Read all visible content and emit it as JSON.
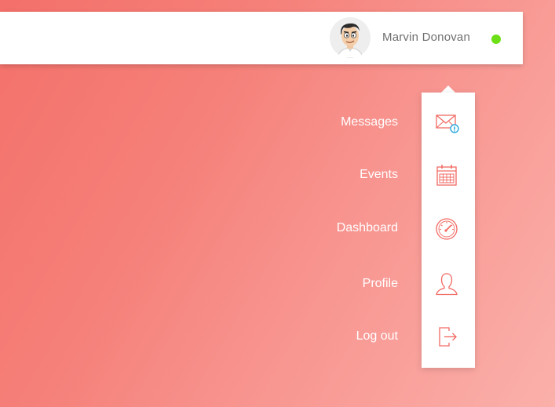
{
  "header": {
    "user_name": "Marvin Donovan",
    "status": "online",
    "status_color": "#6ddf17"
  },
  "menu": {
    "items": [
      {
        "label": "Messages",
        "icon": "mail-icon"
      },
      {
        "label": "Events",
        "icon": "calendar-icon"
      },
      {
        "label": "Dashboard",
        "icon": "speedometer-icon"
      },
      {
        "label": "Profile",
        "icon": "user-icon"
      },
      {
        "label": "Log out",
        "icon": "logout-icon"
      }
    ]
  },
  "colors": {
    "accent": "#f26a63",
    "background_start": "#f4706a",
    "background_end": "#fbb0aa",
    "notification": "#2aa8e0"
  }
}
